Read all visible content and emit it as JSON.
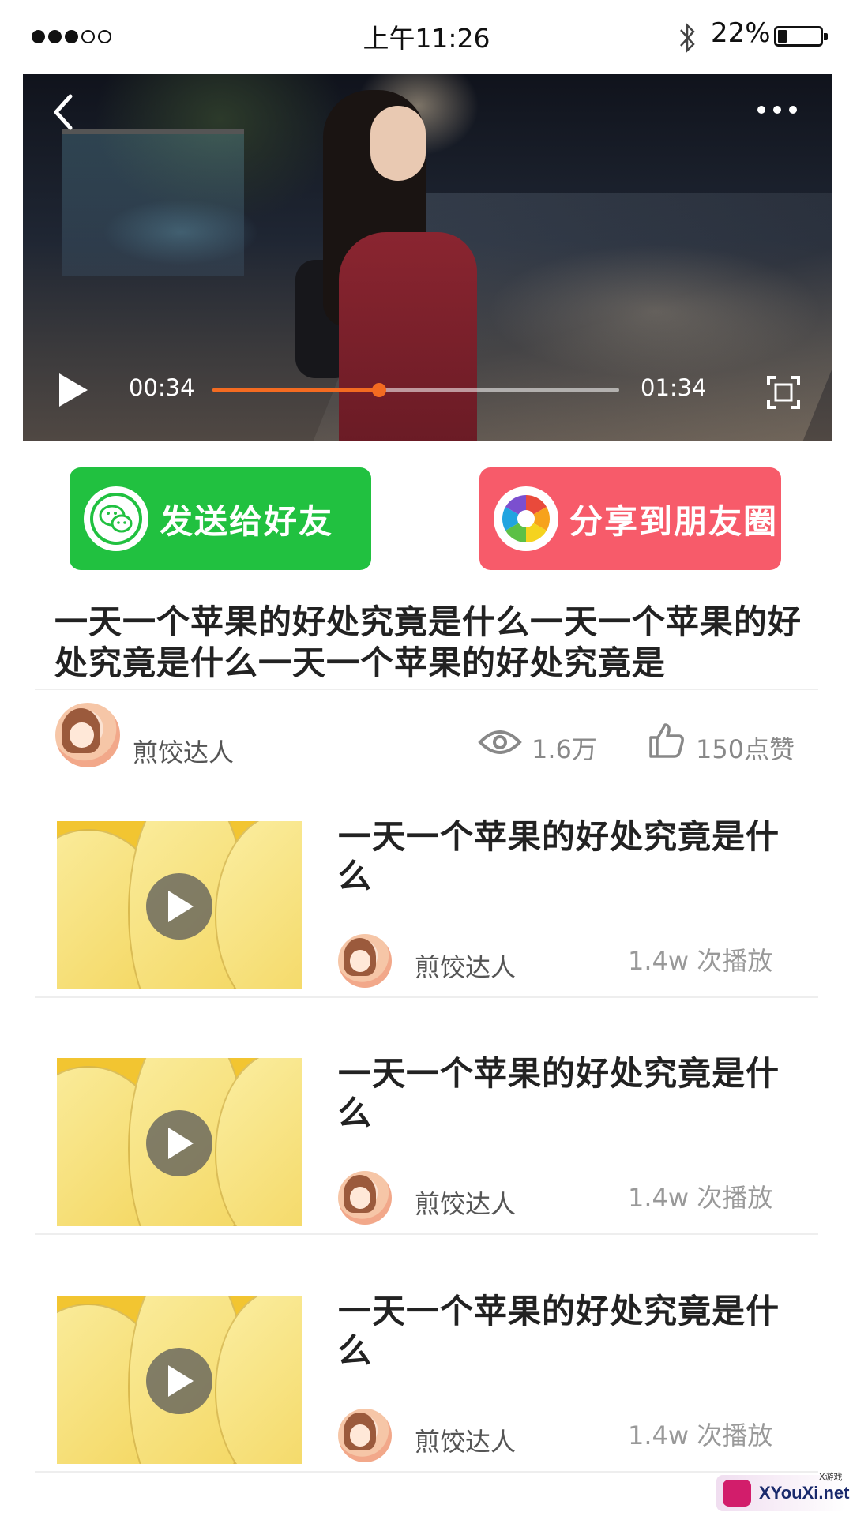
{
  "status_bar": {
    "signal_filled": 3,
    "signal_total": 5,
    "time": "上午11:26",
    "battery_percent_text": "22%",
    "battery_level": 0.22
  },
  "player": {
    "current_time": "00:34",
    "total_time": "01:34",
    "progress": 0.41,
    "progress_color": "#f36b21"
  },
  "share": {
    "wechat_label": "发送给好友",
    "wechat_color": "#21c140",
    "moments_label": "分享到朋友圈",
    "moments_color": "#f75b6a"
  },
  "article": {
    "title": "一天一个苹果的好处究竟是什么一天一个苹果的好处究竟是什么一天一个苹果的好处究竟是",
    "author": "煎饺达人",
    "views": "1.6万",
    "likes": "150点赞"
  },
  "related": [
    {
      "title": "一天一个苹果的好处究竟是什么",
      "author": "煎饺达人",
      "plays": "1.4w 次播放"
    },
    {
      "title": "一天一个苹果的好处究竟是什么",
      "author": "煎饺达人",
      "plays": "1.4w 次播放"
    },
    {
      "title": "一天一个苹果的好处究竟是什么",
      "author": "煎饺达人",
      "plays": "1.4w 次播放"
    }
  ],
  "watermark": {
    "text": "XYouXi.net",
    "small": "X游戏"
  }
}
